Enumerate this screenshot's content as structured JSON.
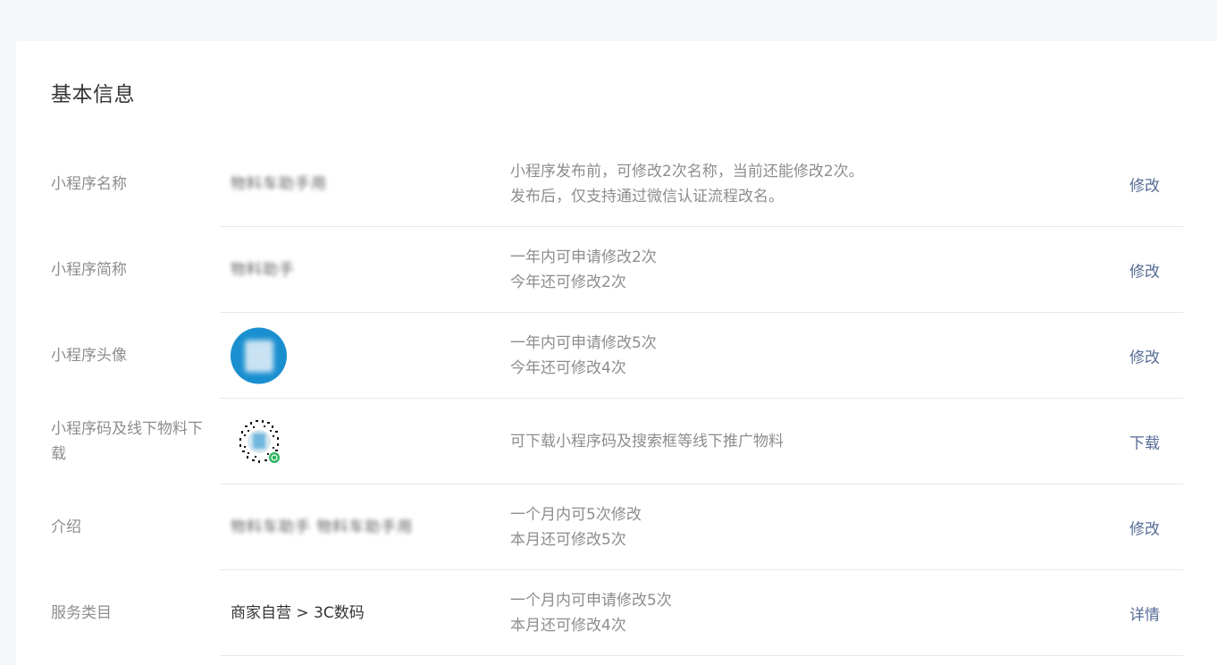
{
  "section": {
    "title": "基本信息"
  },
  "rows": [
    {
      "label": "小程序名称",
      "value": "物料车助手用",
      "hint": [
        "小程序发布前，可修改2次名称，当前还能修改2次。",
        "发布后，仅支持通过微信认证流程改名。"
      ],
      "action": "修改"
    },
    {
      "label": "小程序简称",
      "value": "物料助手",
      "hint": [
        "一年内可申请修改2次",
        "今年还可修改2次"
      ],
      "action": "修改"
    },
    {
      "label": "小程序头像",
      "value": "",
      "hint": [
        "一年内可申请修改5次",
        "今年还可修改4次"
      ],
      "action": "修改"
    },
    {
      "label": "小程序码及线下物料下载",
      "value": "",
      "hint": [
        "可下载小程序码及搜索框等线下推广物料"
      ],
      "action": "下载"
    },
    {
      "label": "介绍",
      "value": "物料车助手 物料车助手用",
      "hint": [
        "一个月内可5次修改",
        "本月还可修改5次"
      ],
      "action": "修改"
    },
    {
      "label": "服务类目",
      "value": "商家自营 > 3C数码",
      "hint": [
        "一个月内可申请修改5次",
        "本月还可修改4次"
      ],
      "action": "详情"
    }
  ],
  "colors": {
    "link": "#576b95",
    "label": "#8d8d8d",
    "divider": "#e7e7eb",
    "avatar": "#1a8fd0"
  }
}
